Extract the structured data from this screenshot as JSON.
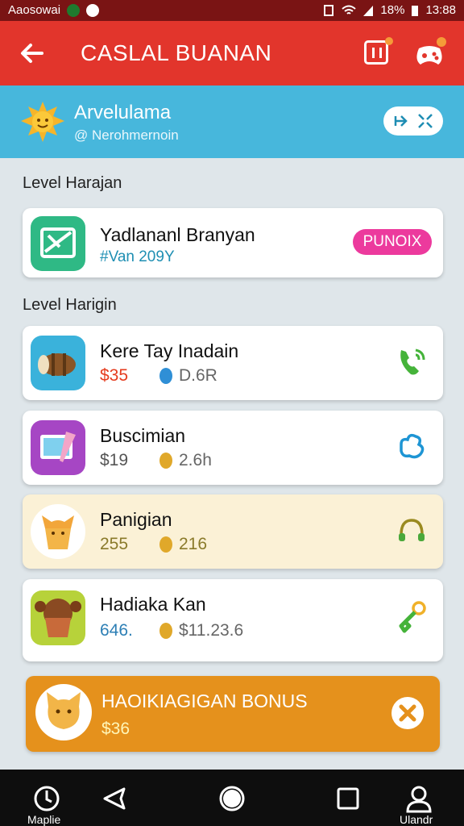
{
  "status": {
    "left_text": "Aaosowai",
    "battery": "18%",
    "time": "13:88"
  },
  "appbar": {
    "title": "CASLAL BUANAN"
  },
  "profile": {
    "name": "Arvelulama",
    "subtitle": "@ Nerohmernoin",
    "button_icons": [
      "arrow-in-icon",
      "shrink-icon"
    ]
  },
  "sections": [
    {
      "label": "Level Harajan"
    },
    {
      "label": "Level Harigin"
    }
  ],
  "featured": {
    "title": "Yadlananl Branyan",
    "subtitle": "#Van 209Y",
    "pill": "PUNOIX"
  },
  "items": [
    {
      "title": "Kere Tay Inadain",
      "value": "$35",
      "coins": "D.6R",
      "value_color": "#e53b1e"
    },
    {
      "title": "Buscimian",
      "value": "$19",
      "coins": "2.6h",
      "value_color": "#555555"
    },
    {
      "title": "Panigian",
      "value": "255",
      "coins": "216",
      "value_color": "#8a7a2a"
    },
    {
      "title": "Hadiaka Kan",
      "value": "646.",
      "coins": "$11.23.6",
      "value_color": "#2d7fb5"
    }
  ],
  "bonus": {
    "title": "HAOIKIAGIGAN BONUS",
    "value": "$36"
  },
  "nav": {
    "left_label": "Maplie",
    "right_label": "Ulandr"
  },
  "colors": {
    "appbar": "#e2352c",
    "profile": "#47b7dc",
    "bonus": "#e5911c",
    "pill": "#ec3a9d"
  }
}
